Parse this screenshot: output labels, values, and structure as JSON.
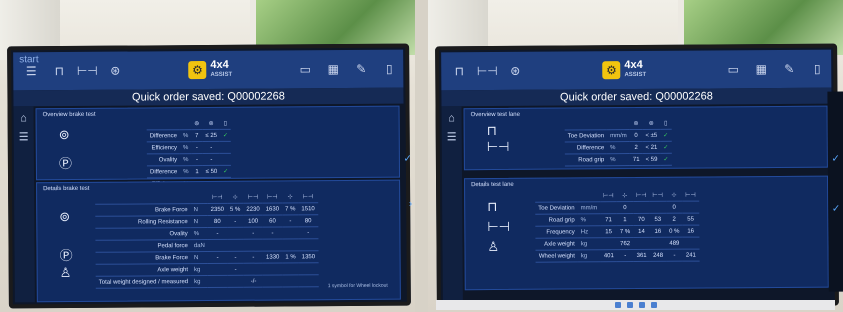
{
  "left": {
    "brand": "start",
    "title": "Quick order saved: Q00002268",
    "toolbar": {
      "mode_main": "4x4",
      "mode_sub": "ASSIST"
    },
    "overview": {
      "label": "Overview brake test",
      "rows": [
        {
          "label": "Difference",
          "unit": "%",
          "v1": "7",
          "v2": "≤ 25"
        },
        {
          "label": "Efficiency",
          "unit": "%",
          "v1": "-",
          "v2": "-"
        },
        {
          "label": "Ovality",
          "unit": "%",
          "v1": "-",
          "v2": "-"
        },
        {
          "label": "Difference",
          "unit": "%",
          "v1": "1",
          "v2": "≤ 50"
        },
        {
          "label": "Efficiency",
          "unit": "%",
          "v1": "-",
          "v2": "-"
        }
      ]
    },
    "details": {
      "label": "Details brake test",
      "rows": [
        {
          "label": "Brake Force",
          "unit": "N",
          "c": [
            "2350",
            "5 %",
            "2230",
            "1630",
            "7 %",
            "1510"
          ]
        },
        {
          "label": "Rolling Resistance",
          "unit": "N",
          "c": [
            "80",
            "-",
            "100",
            "60",
            "-",
            "80"
          ]
        },
        {
          "label": "Ovality",
          "unit": "%",
          "c": [
            "-",
            "",
            "-",
            "-",
            "",
            "-"
          ]
        },
        {
          "label": "Pedal force",
          "unit": "daN",
          "c": [
            "",
            "",
            "",
            "",
            "",
            ""
          ]
        },
        {
          "label": "Brake Force",
          "unit": "N",
          "c": [
            "-",
            "-",
            "-",
            "1330",
            "1 %",
            "1350"
          ]
        },
        {
          "label": "Axle weight",
          "unit": "kg",
          "c": [
            "",
            "-",
            "",
            "",
            "",
            ""
          ]
        },
        {
          "label": "Total weight designed / measured",
          "unit": "kg",
          "c": [
            "",
            "",
            "-/-",
            "",
            "",
            ""
          ]
        }
      ],
      "footnote": "1 symbol for Wheel lockout"
    }
  },
  "right": {
    "title": "Quick order saved: Q00002268",
    "toolbar": {
      "mode_main": "4x4",
      "mode_sub": "ASSIST"
    },
    "overview": {
      "label": "Overview test lane",
      "rows": [
        {
          "label": "Toe Deviation",
          "unit": "mm/m",
          "v1": "0",
          "v2": "< ±5"
        },
        {
          "label": "Difference",
          "unit": "%",
          "v1": "2",
          "v2": "< 21"
        },
        {
          "label": "Road grip",
          "unit": "%",
          "v1": "71",
          "v2": "< 59"
        }
      ]
    },
    "details": {
      "label": "Details test lane",
      "rows": [
        {
          "label": "Toe Deviation",
          "unit": "mm/m",
          "c": [
            "",
            "0",
            "",
            "",
            "0",
            ""
          ]
        },
        {
          "label": "Road grip",
          "unit": "%",
          "c": [
            "71",
            "1",
            "70",
            "53",
            "2",
            "55"
          ]
        },
        {
          "label": "Frequency",
          "unit": "Hz",
          "c": [
            "15",
            "7 %",
            "14",
            "16",
            "0 %",
            "16"
          ]
        },
        {
          "label": "Axle weight",
          "unit": "kg",
          "c": [
            "",
            "762",
            "",
            "",
            "489",
            ""
          ]
        },
        {
          "label": "Wheel weight",
          "unit": "kg",
          "c": [
            "401",
            "-",
            "361",
            "248",
            "-",
            "241"
          ]
        }
      ]
    }
  }
}
